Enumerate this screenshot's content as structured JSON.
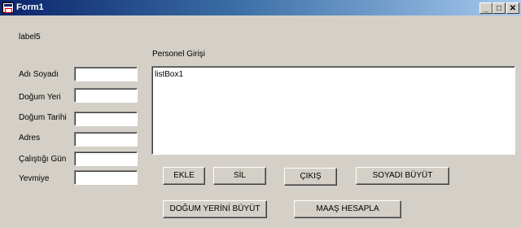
{
  "window": {
    "title": "Form1",
    "minimize": "_",
    "maximize": "□",
    "close": "✕"
  },
  "label5": "label5",
  "section_title": "Personel Girişi",
  "fields": [
    {
      "label": "Adı Soyadı",
      "value": ""
    },
    {
      "label": "Doğum Yeri",
      "value": ""
    },
    {
      "label": "Doğum Tarihi",
      "value": ""
    },
    {
      "label": "Adres",
      "value": ""
    },
    {
      "label": "Çalıştığı Gün",
      "value": ""
    },
    {
      "label": "Yevmiye",
      "value": ""
    }
  ],
  "listbox": {
    "text": "listBox1"
  },
  "buttons": {
    "ekle": "EKLE",
    "sil": "SİL",
    "cikis": "ÇIKIŞ",
    "soyadi_buyut": "SOYADI BÜYÜT",
    "dogum_yerini_buyut": "DOĞUM YERİNİ BÜYÜT",
    "maas_hesapla": "MAAŞ HESAPLA"
  }
}
